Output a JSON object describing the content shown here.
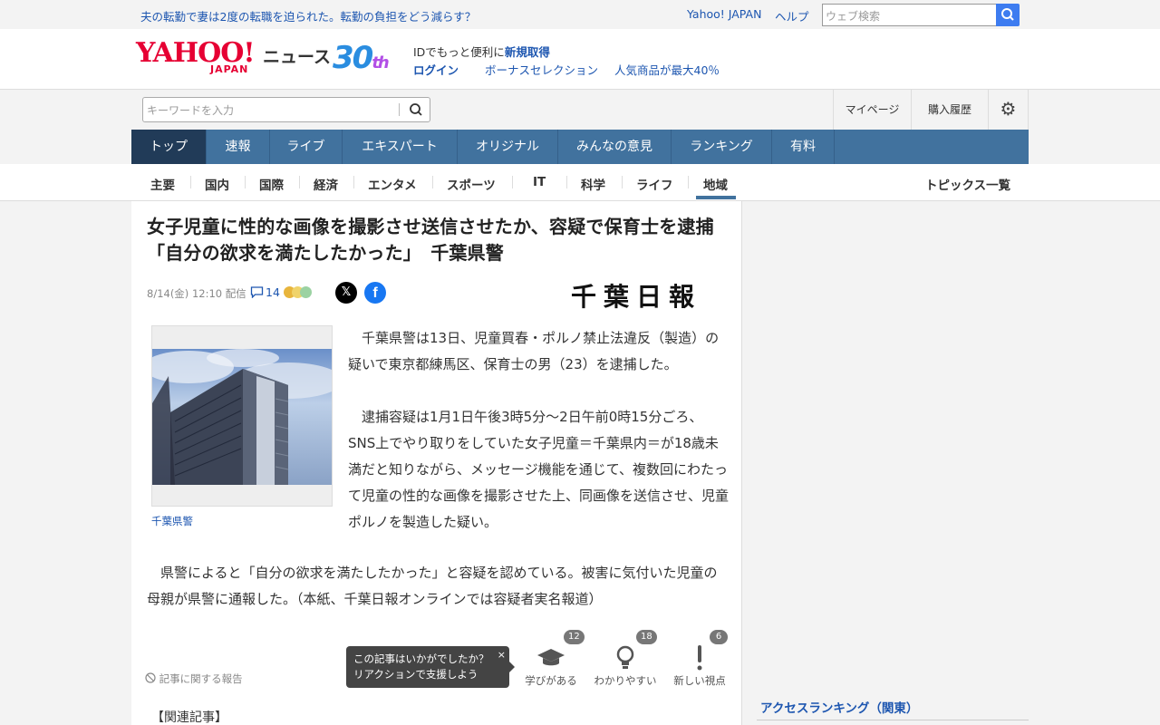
{
  "topbar": {
    "promo": "夫の転勤で妻は2度の転職を迫られた。転勤の負担をどう減らす？",
    "yahoo_japan": "Yahoo! JAPAN",
    "help": "ヘルプ",
    "web_search_placeholder": "ウェブ検索"
  },
  "header": {
    "logo_text": "YAHOO!",
    "logo_sub": "JAPAN",
    "news": "ニュース",
    "anniv": "30",
    "anniv_suffix": "th",
    "id_prefix": "IDでもっと便利に",
    "id_link": "新規取得",
    "login": "ログイン",
    "bonus": "ボーナスセレクション",
    "ninki": "人気商品が最大40％"
  },
  "search": {
    "placeholder": "キーワードを入力",
    "mypage": "マイページ",
    "history": "購入履歴"
  },
  "nav": {
    "items": [
      "トップ",
      "速報",
      "ライブ",
      "エキスパート",
      "オリジナル",
      "みんなの意見",
      "ランキング",
      "有料"
    ]
  },
  "subnav": {
    "items": [
      "主要",
      "国内",
      "国際",
      "経済",
      "エンタメ",
      "スポーツ",
      "IT",
      "科学",
      "ライフ",
      "地域"
    ],
    "topics": "トピックス一覧"
  },
  "article": {
    "title": "女子児童に性的な画像を撮影させ送信させたか、容疑で保育士を逮捕　「自分の欲求を満たしたかった」　千葉県警",
    "date": "8/14(金) 12:10",
    "haishin": "配信",
    "comment_count": "14",
    "source": "千葉日報",
    "photo_caption": "千葉県警",
    "paragraphs": [
      "　千葉県警は13日、児童買春・ポルノ禁止法違反（製造）の疑いで東京都練馬区、保育士の男（23）を逮捕した。",
      "　逮捕容疑は1月1日午後3時5分～2日午前0時15分ごろ、SNS上でやり取りをしていた女子児童＝千葉県内＝が18歳未満だと知りながら、メッセージ機能を通じて、複数回にわたって児童の性的な画像を撮影させた上、同画像を送信させ、児童ポルノを製造した疑い。",
      "　県警によると「自分の欲求を満たしたかった」と容疑を認めている。被害に気付いた児童の母親が県警に通報した。（本紙、千葉日報オンラインでは容疑者実名報道）"
    ],
    "report": "記事に関する報告",
    "tooltip_line1": "この記事はいかがでしたか？",
    "tooltip_line2": "リアクションで支援しよう",
    "tooltip_close": "×",
    "reactions": [
      {
        "label": "学びがある",
        "count": "12",
        "icon": "graduation-cap-icon"
      },
      {
        "label": "わかりやすい",
        "count": "18",
        "icon": "lightbulb-icon"
      },
      {
        "label": "新しい視点",
        "count": "6",
        "icon": "exclamation-icon"
      }
    ],
    "related": "【関連記事】"
  },
  "sidebar": {
    "access_ranking": "アクセスランキング（関東）"
  },
  "colors": {
    "nav_bg": "#41729e",
    "nav_active": "#213b58",
    "link": "#1d56b0",
    "brand_red": "#e60033"
  }
}
